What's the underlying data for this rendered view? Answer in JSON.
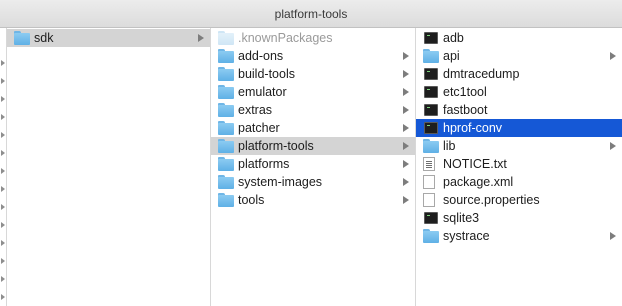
{
  "window": {
    "title": "platform-tools"
  },
  "column1": {
    "items": [
      {
        "label": "sdk",
        "kind": "folder",
        "has_children": true,
        "selected": "gray"
      }
    ]
  },
  "column2": {
    "items": [
      {
        "label": ".knownPackages",
        "kind": "folder-faded",
        "has_children": false,
        "dim": true
      },
      {
        "label": "add-ons",
        "kind": "folder",
        "has_children": true
      },
      {
        "label": "build-tools",
        "kind": "folder",
        "has_children": true
      },
      {
        "label": "emulator",
        "kind": "folder",
        "has_children": true
      },
      {
        "label": "extras",
        "kind": "folder",
        "has_children": true
      },
      {
        "label": "patcher",
        "kind": "folder",
        "has_children": true
      },
      {
        "label": "platform-tools",
        "kind": "folder",
        "has_children": true,
        "selected": "gray"
      },
      {
        "label": "platforms",
        "kind": "folder",
        "has_children": true
      },
      {
        "label": "system-images",
        "kind": "folder",
        "has_children": true
      },
      {
        "label": "tools",
        "kind": "folder",
        "has_children": true
      }
    ]
  },
  "column3": {
    "items": [
      {
        "label": "adb",
        "kind": "exec",
        "has_children": false
      },
      {
        "label": "api",
        "kind": "folder",
        "has_children": true
      },
      {
        "label": "dmtracedump",
        "kind": "exec",
        "has_children": false
      },
      {
        "label": "etc1tool",
        "kind": "exec",
        "has_children": false
      },
      {
        "label": "fastboot",
        "kind": "exec",
        "has_children": false
      },
      {
        "label": "hprof-conv",
        "kind": "exec",
        "has_children": false,
        "selected": "blue"
      },
      {
        "label": "lib",
        "kind": "folder",
        "has_children": true
      },
      {
        "label": "NOTICE.txt",
        "kind": "doc-txt",
        "has_children": false
      },
      {
        "label": "package.xml",
        "kind": "doc",
        "has_children": false
      },
      {
        "label": "source.properties",
        "kind": "doc",
        "has_children": false
      },
      {
        "label": "sqlite3",
        "kind": "exec",
        "has_children": false
      },
      {
        "label": "systrace",
        "kind": "folder",
        "has_children": true
      }
    ]
  },
  "colors": {
    "selection_blue": "#1558d6",
    "selection_gray": "#d4d4d4",
    "folder": "#6fb6e6"
  }
}
